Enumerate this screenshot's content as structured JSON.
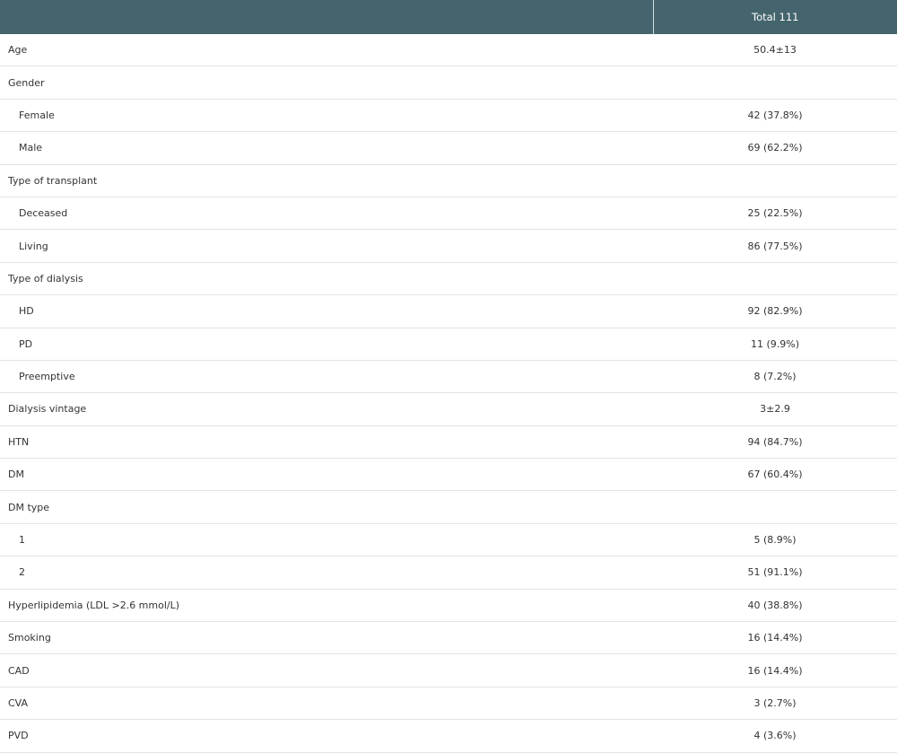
{
  "header": {
    "label": "",
    "value": "Total 111"
  },
  "rows": [
    {
      "label": "Age",
      "value": "50.4±13",
      "indent": false
    },
    {
      "label": "Gender",
      "value": "",
      "indent": false
    },
    {
      "label": "Female",
      "value": "42 (37.8%)",
      "indent": true
    },
    {
      "label": "Male",
      "value": "69 (62.2%)",
      "indent": true
    },
    {
      "label": "Type of transplant",
      "value": "",
      "indent": false
    },
    {
      "label": "Deceased",
      "value": "25 (22.5%)",
      "indent": true
    },
    {
      "label": "Living",
      "value": "86 (77.5%)",
      "indent": true
    },
    {
      "label": "Type of dialysis",
      "value": "",
      "indent": false
    },
    {
      "label": "HD",
      "value": "92 (82.9%)",
      "indent": true
    },
    {
      "label": "PD",
      "value": "11 (9.9%)",
      "indent": true
    },
    {
      "label": "Preemptive",
      "value": "8 (7.2%)",
      "indent": true
    },
    {
      "label": "Dialysis vintage",
      "value": "3±2.9",
      "indent": false
    },
    {
      "label": "HTN",
      "value": "94 (84.7%)",
      "indent": false
    },
    {
      "label": "DM",
      "value": "67 (60.4%)",
      "indent": false
    },
    {
      "label": "DM type",
      "value": "",
      "indent": false
    },
    {
      "label": "1",
      "value": "5 (8.9%)",
      "indent": true
    },
    {
      "label": "2",
      "value": "51 (91.1%)",
      "indent": true
    },
    {
      "label": "Hyperlipidemia (LDL >2.6 mmol/L)",
      "value": "40 (38.8%)",
      "indent": false
    },
    {
      "label": "Smoking",
      "value": "16 (14.4%)",
      "indent": false
    },
    {
      "label": "CAD",
      "value": "16 (14.4%)",
      "indent": false
    },
    {
      "label": "CVA",
      "value": "3 (2.7%)",
      "indent": false
    },
    {
      "label": "PVD",
      "value": "4 (3.6%)",
      "indent": false
    }
  ]
}
